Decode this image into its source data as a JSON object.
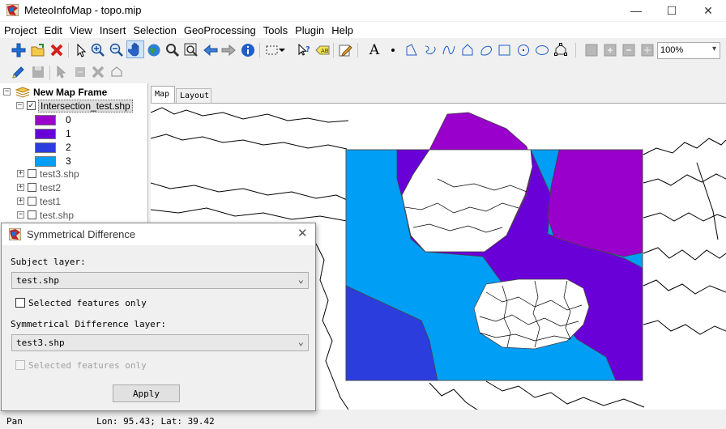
{
  "window": {
    "title": "MeteoInfoMap - topo.mip",
    "controls": {
      "minimize": "—",
      "maximize": "☐",
      "close": "✕"
    }
  },
  "menu": [
    "Project",
    "Edit",
    "View",
    "Insert",
    "Selection",
    "GeoProcessing",
    "Tools",
    "Plugin",
    "Help"
  ],
  "toolbar": {
    "zoom_value": "100%"
  },
  "legend": {
    "frame_label": "New Map Frame",
    "active_layer": "Intersection_test.shp",
    "classes": [
      {
        "label": "0",
        "color": "#9900cc"
      },
      {
        "label": "1",
        "color": "#6a00d8"
      },
      {
        "label": "2",
        "color": "#2c3ddd"
      },
      {
        "label": "3",
        "color": "#009ef5"
      }
    ],
    "other_layers": [
      "test3.shp",
      "test2",
      "test1",
      "test.shp"
    ]
  },
  "tabs": {
    "map": "Map",
    "layout": "Layout"
  },
  "status": {
    "mode": "Pan",
    "coords": "Lon: 95.43; Lat: 39.42"
  },
  "dialog": {
    "title": "Symmetrical Difference",
    "subject_label": "Subject layer:",
    "subject_value": "test.shp",
    "selected_only_1": "Selected features only",
    "diff_label": "Symmetrical Difference layer:",
    "diff_value": "test3.shp",
    "selected_only_2": "Selected features only",
    "apply": "Apply"
  }
}
